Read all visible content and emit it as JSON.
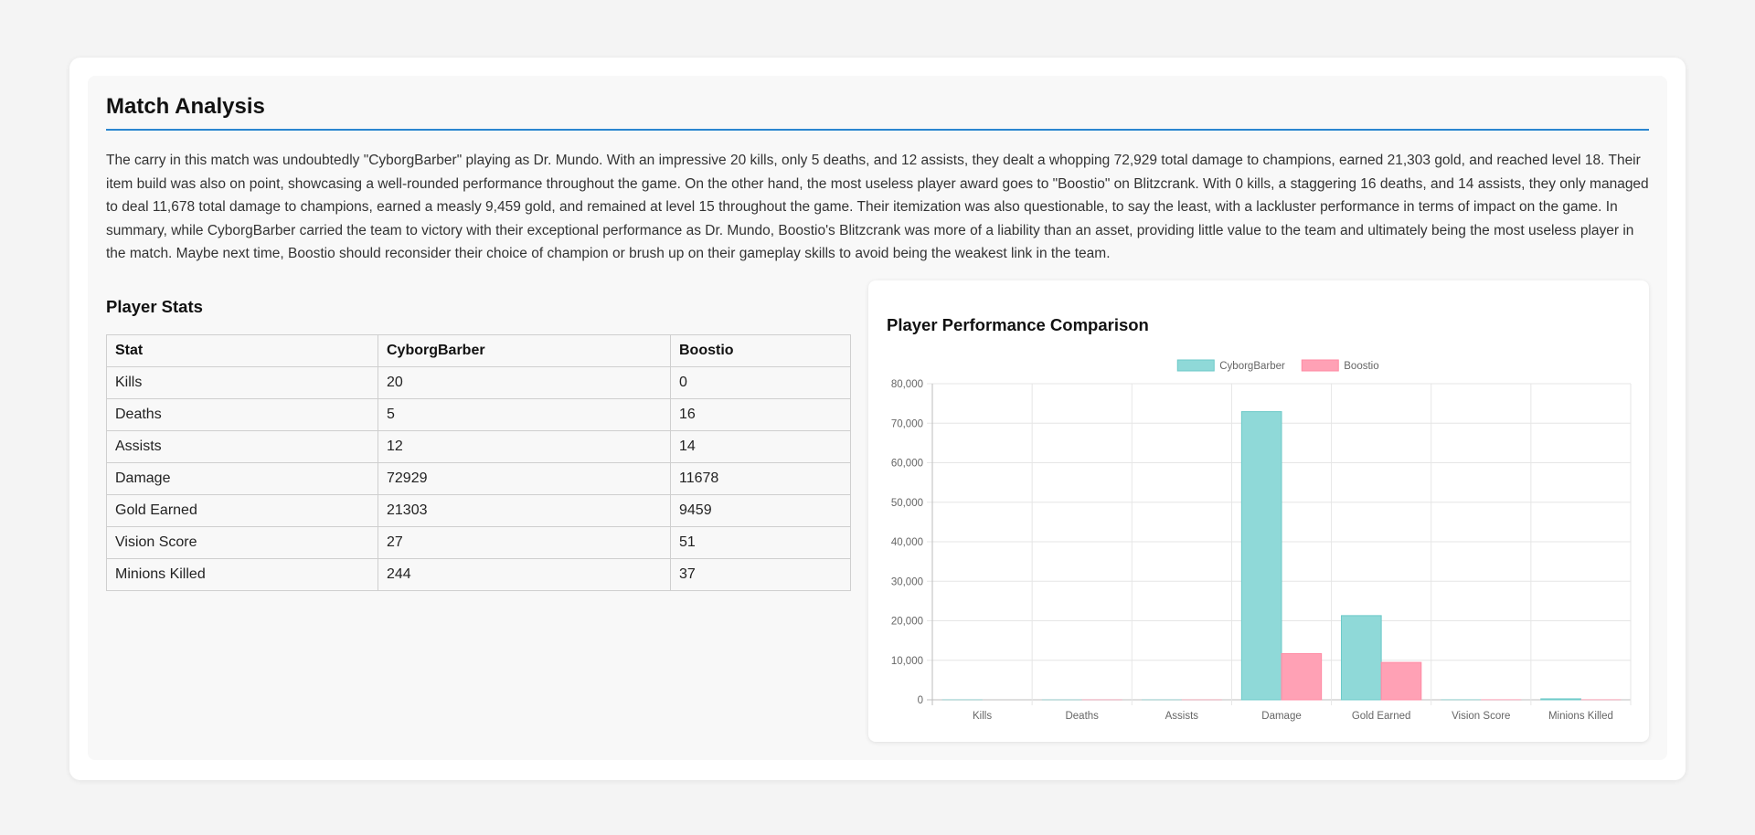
{
  "page": {
    "title": "Match Analysis",
    "summary": "The carry in this match was undoubtedly \"CyborgBarber\" playing as Dr. Mundo. With an impressive 20 kills, only 5 deaths, and 12 assists, they dealt a whopping 72,929 total damage to champions, earned 21,303 gold, and reached level 18. Their item build was also on point, showcasing a well-rounded performance throughout the game. On the other hand, the most useless player award goes to \"Boostio\" on Blitzcrank. With 0 kills, a staggering 16 deaths, and 14 assists, they only managed to deal 11,678 total damage to champions, earned a measly 9,459 gold, and remained at level 15 throughout the game. Their itemization was also questionable, to say the least, with a lackluster performance in terms of impact on the game. In summary, while CyborgBarber carried the team to victory with their exceptional performance as Dr. Mundo, Boostio's Blitzcrank was more of a liability than an asset, providing little value to the team and ultimately being the most useless player in the match. Maybe next time, Boostio should reconsider their choice of champion or brush up on their gameplay skills to avoid being the weakest link in the team."
  },
  "stats": {
    "title": "Player Stats",
    "headers": [
      "Stat",
      "CyborgBarber",
      "Boostio"
    ],
    "rows": [
      [
        "Kills",
        "20",
        "0"
      ],
      [
        "Deaths",
        "5",
        "16"
      ],
      [
        "Assists",
        "12",
        "14"
      ],
      [
        "Damage",
        "72929",
        "11678"
      ],
      [
        "Gold Earned",
        "21303",
        "9459"
      ],
      [
        "Vision Score",
        "27",
        "51"
      ],
      [
        "Minions Killed",
        "244",
        "37"
      ]
    ]
  },
  "chart_title": "Player Performance Comparison",
  "chart_data": {
    "type": "bar",
    "categories": [
      "Kills",
      "Deaths",
      "Assists",
      "Damage",
      "Gold Earned",
      "Vision Score",
      "Minions Killed"
    ],
    "series": [
      {
        "name": "CyborgBarber",
        "values": [
          20,
          5,
          12,
          72929,
          21303,
          27,
          244
        ],
        "color": "#8fd9d8",
        "border": "#6cc9c8"
      },
      {
        "name": "Boostio",
        "values": [
          0,
          16,
          14,
          11678,
          9459,
          51,
          37
        ],
        "color": "#ffa1b5",
        "border": "#ff8aa3"
      }
    ],
    "ylim": [
      0,
      80000
    ],
    "yticks": [
      0,
      10000,
      20000,
      30000,
      40000,
      50000,
      60000,
      70000,
      80000
    ],
    "ytick_labels": [
      "0",
      "10,000",
      "20,000",
      "30,000",
      "40,000",
      "50,000",
      "60,000",
      "70,000",
      "80,000"
    ],
    "grid": true,
    "legend": "top-center"
  }
}
